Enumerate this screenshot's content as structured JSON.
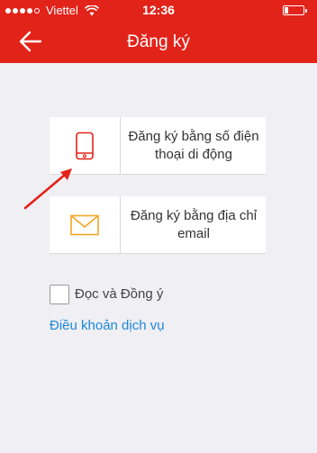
{
  "status_bar": {
    "carrier": "Viettel",
    "time": "12:36",
    "signal_bars_filled": 4,
    "signal_bars_total": 5,
    "wifi_icon": "wifi-icon",
    "battery_level_fraction": 0.15
  },
  "nav": {
    "title": "Đăng ký",
    "back_icon": "back-arrow-icon"
  },
  "options": {
    "phone": {
      "label": "Đăng ký bằng số điện thoại di động",
      "icon": "mobile-phone-icon"
    },
    "email": {
      "label": "Đăng ký bằng địa chỉ email",
      "icon": "envelope-icon"
    }
  },
  "agreement": {
    "checked": false,
    "label": "Đọc và Đồng ý",
    "terms_link": "Điều khoản dịch vụ"
  },
  "colors": {
    "brand": "#e2231a",
    "link": "#1e88d8",
    "phone_icon": "#e2231a",
    "email_icon": "#f5a623",
    "annotation_arrow": "#e2231a",
    "background": "#efeff4"
  }
}
